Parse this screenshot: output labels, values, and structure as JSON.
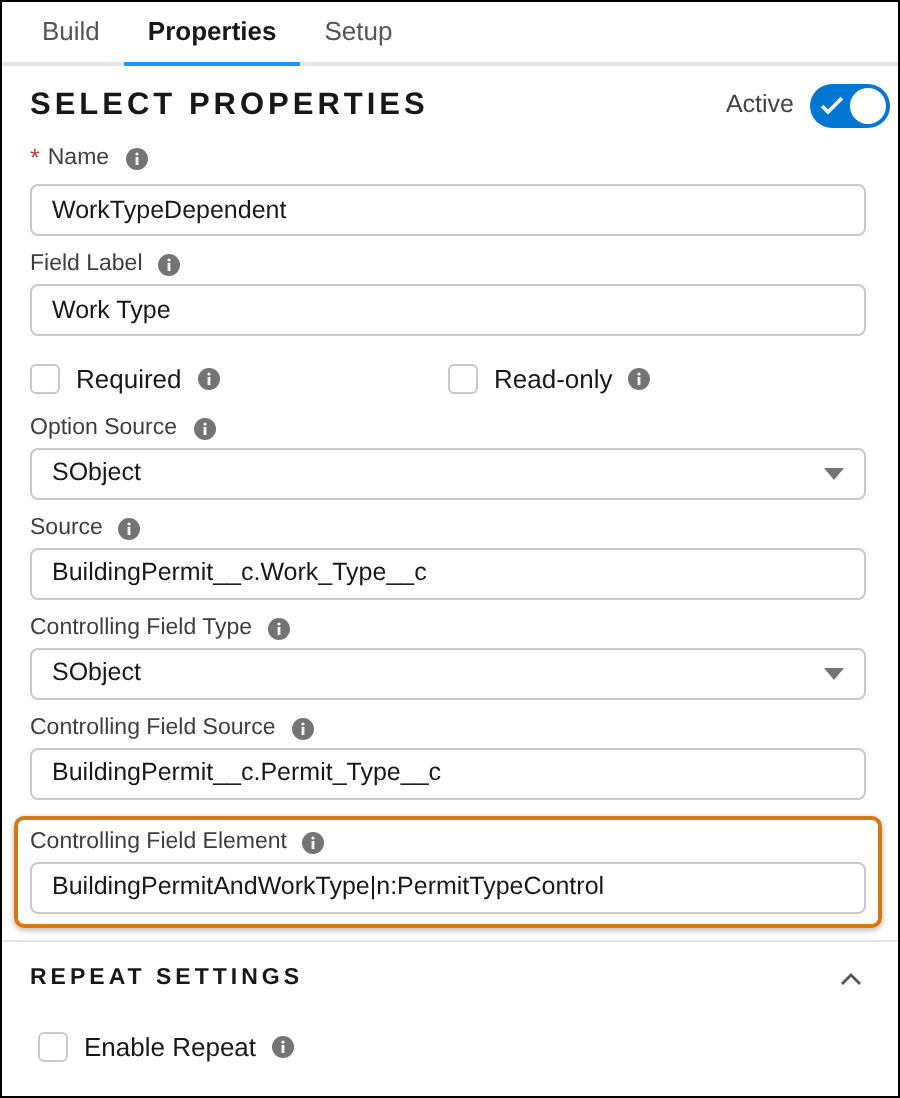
{
  "tabs": [
    {
      "label": "Build",
      "selected": false
    },
    {
      "label": "Properties",
      "selected": true
    },
    {
      "label": "Setup",
      "selected": false
    }
  ],
  "required_marker": "*",
  "section": {
    "title": "SELECT PROPERTIES",
    "active_label": "Active",
    "active": true
  },
  "fields": [
    {
      "kind": "text",
      "label": "Name",
      "required": true,
      "value": "WorkTypeDependent",
      "highlighted": false
    },
    {
      "kind": "text",
      "label": "Field Label",
      "required": false,
      "value": "Work Type",
      "highlighted": false
    },
    {
      "kind": "checkboxes",
      "items": [
        {
          "label": "Required",
          "checked": false
        },
        {
          "label": "Read-only",
          "checked": false
        }
      ]
    },
    {
      "kind": "select",
      "label": "Option Source",
      "required": false,
      "value": "SObject",
      "highlighted": false
    },
    {
      "kind": "text",
      "label": "Source",
      "required": false,
      "value": "BuildingPermit__c.Work_Type__c",
      "highlighted": false
    },
    {
      "kind": "select",
      "label": "Controlling Field Type",
      "required": false,
      "value": "SObject",
      "highlighted": false
    },
    {
      "kind": "text",
      "label": "Controlling Field Source",
      "required": false,
      "value": "BuildingPermit__c.Permit_Type__c",
      "highlighted": false
    },
    {
      "kind": "text",
      "label": "Controlling Field Element",
      "required": false,
      "value": "BuildingPermitAndWorkType|n:PermitTypeControl",
      "highlighted": true
    }
  ],
  "repeat": {
    "title": "REPEAT SETTINGS",
    "expanded": true,
    "items": [
      {
        "label": "Enable Repeat",
        "checked": false
      }
    ]
  }
}
